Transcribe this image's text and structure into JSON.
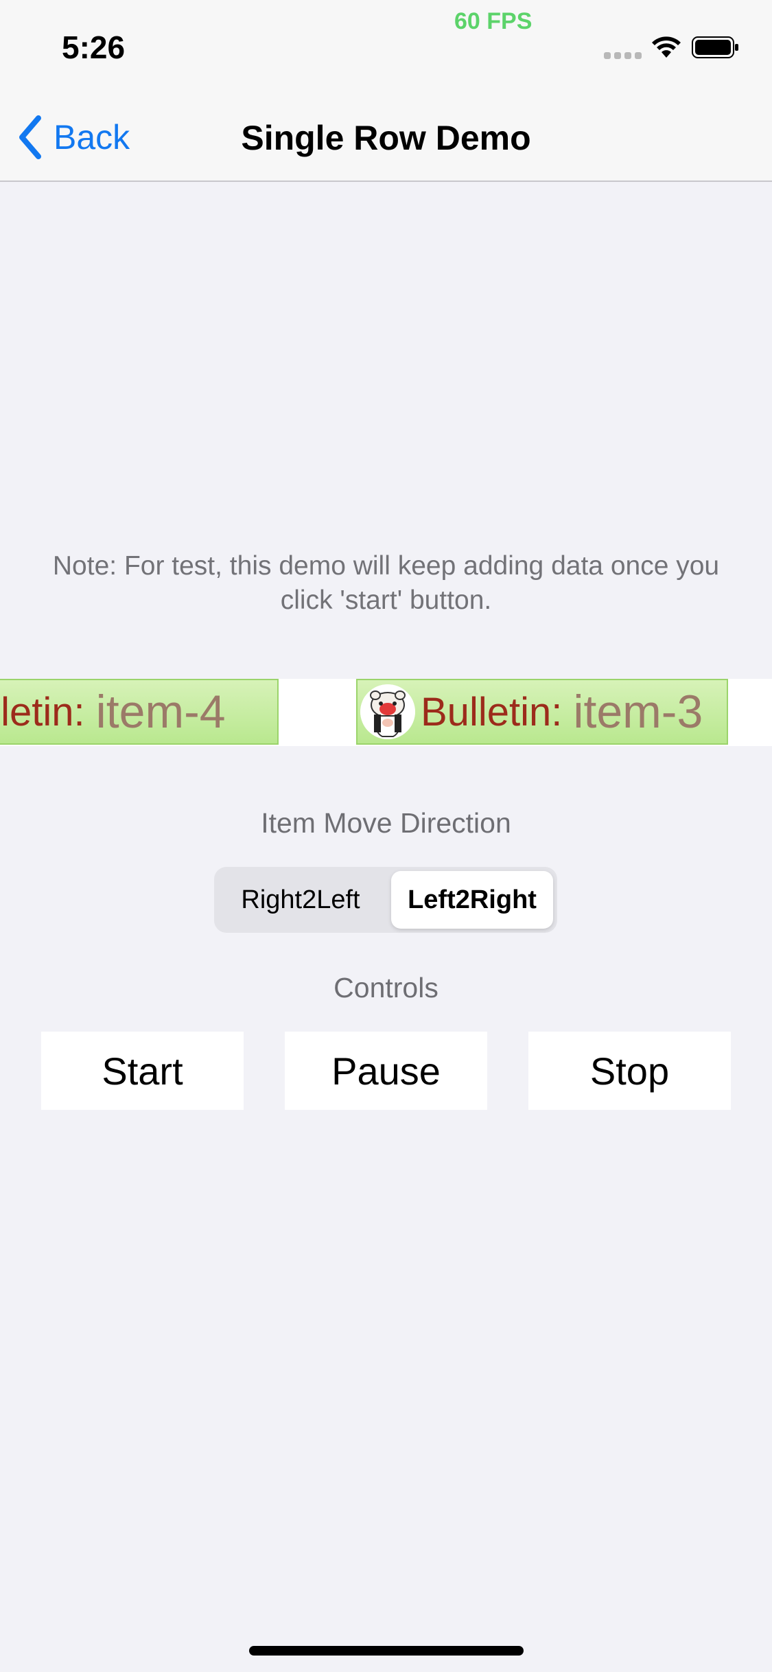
{
  "status_bar": {
    "time": "5:26",
    "fps": "60 FPS"
  },
  "nav": {
    "back_label": "Back",
    "title": "Single Row Demo"
  },
  "note": "Note: For test, this demo will keep adding data once you click 'start' button.",
  "marquee": {
    "bulletins": [
      {
        "prefix": "ulletin:",
        "item": "item-4",
        "has_avatar": false
      },
      {
        "prefix": "Bulletin:",
        "item": "item-3",
        "has_avatar": true
      }
    ]
  },
  "direction": {
    "label": "Item Move Direction",
    "options": [
      "Right2Left",
      "Left2Right"
    ],
    "selected": "Left2Right"
  },
  "controls": {
    "label": "Controls",
    "buttons": [
      "Start",
      "Pause",
      "Stop"
    ]
  },
  "colors": {
    "accent": "#1278f0",
    "fps_green": "#5cd36a",
    "bulletin_prefix": "#9c2b1b",
    "bulletin_bg": "#c6ec9f"
  }
}
